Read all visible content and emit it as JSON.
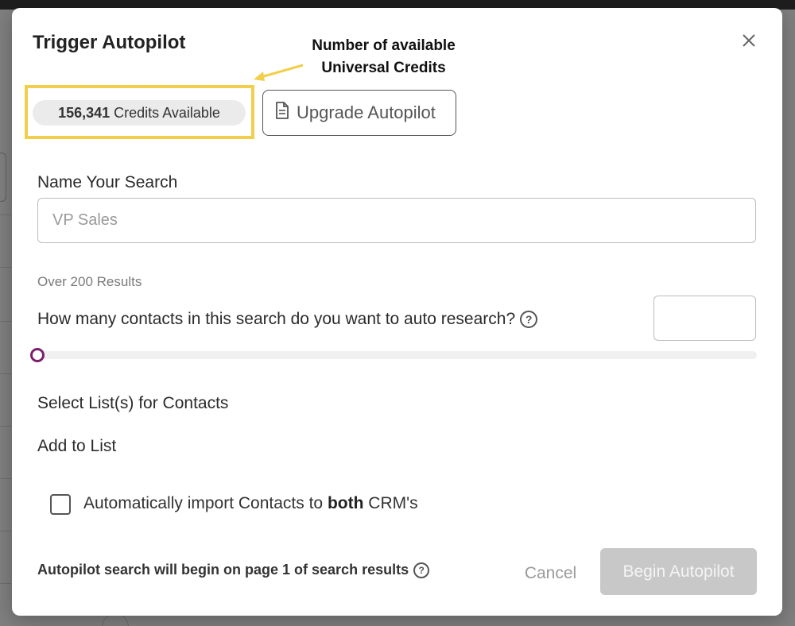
{
  "modal": {
    "title": "Trigger Autopilot",
    "close_icon": "close-icon"
  },
  "annotation": {
    "line1": "Number of available",
    "line2": "Universal Credits",
    "highlight_color": "#f2cf4a"
  },
  "credits": {
    "amount": "156,341",
    "label": "Credits Available"
  },
  "upgrade": {
    "icon": "document-icon",
    "label": "Upgrade Autopilot"
  },
  "name_search": {
    "label": "Name Your Search",
    "placeholder": "VP Sales",
    "value": ""
  },
  "results": {
    "count_text": "Over 200 Results",
    "question": "How many contacts in this search do you want to auto research?",
    "help_icon": "question-circle-icon",
    "input_value": "",
    "slider_value": 0,
    "slider_color": "#7a1f6e"
  },
  "lists": {
    "label": "Select List(s) for Contacts",
    "add_label": "Add to List"
  },
  "import": {
    "checked": false,
    "text_before": "Automatically import Contacts to ",
    "text_bold": "both",
    "text_after": " CRM's"
  },
  "footer": {
    "note": "Autopilot search will begin on page 1 of search results",
    "cancel_label": "Cancel",
    "begin_label": "Begin Autopilot"
  }
}
